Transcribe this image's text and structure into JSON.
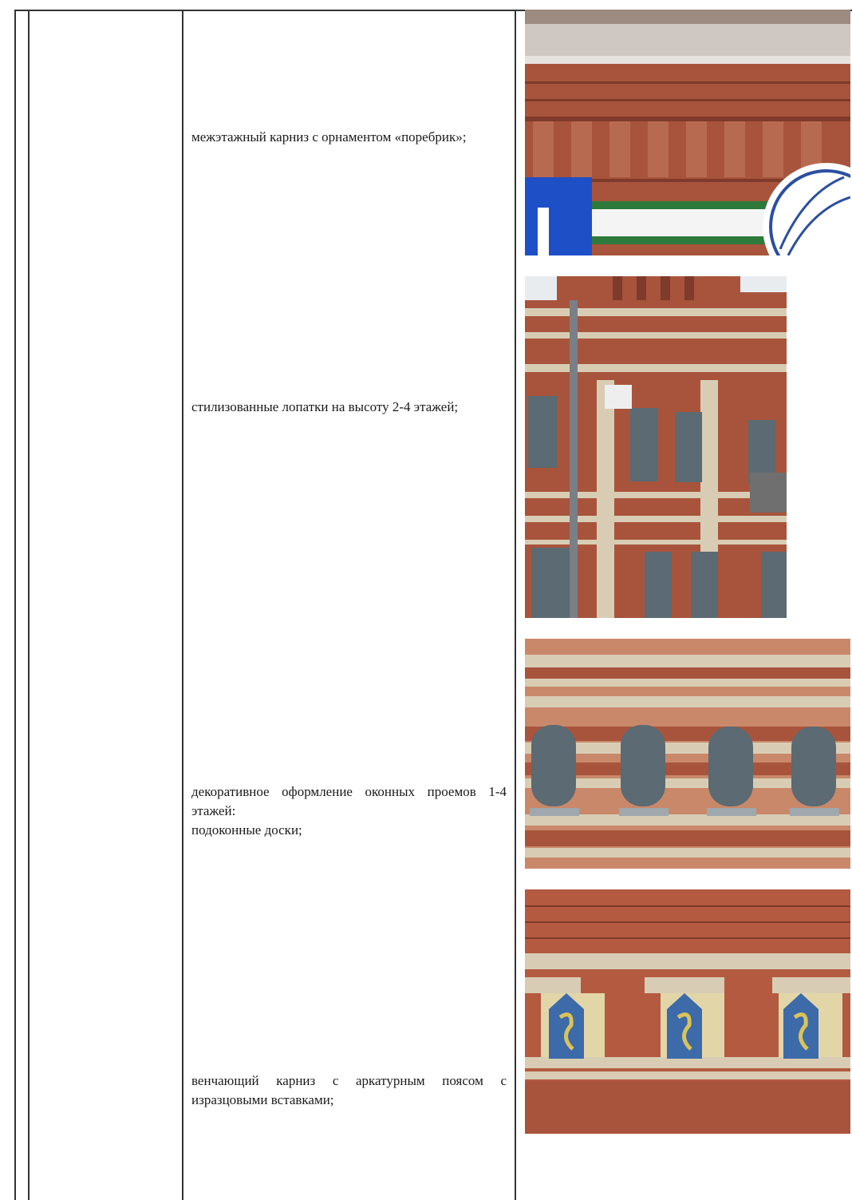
{
  "rows": [
    {
      "lines": [
        "межэтажный карниз с орнаментом «поребрик»;"
      ]
    },
    {
      "lines": [
        "стилизованные лопатки на высоту 2-4 этажей;"
      ]
    },
    {
      "lines": [
        "декоративное оформление оконных проемов 1-4 этажей:",
        "подоконные доски;"
      ]
    },
    {
      "lines": [
        "венчающий карниз с аркатурным поясом с изразцовыми вставками;"
      ]
    }
  ],
  "colors": {
    "brick": "#a8543c",
    "brick_dark": "#7e3a2a",
    "light_brick": "#d8cdb4",
    "sky": "#d7dde3",
    "window": "#5b6a73",
    "tile_blue": "#3d6aa8",
    "tile_yellow": "#d9c35a",
    "sign_blue": "#1f4fc7"
  }
}
